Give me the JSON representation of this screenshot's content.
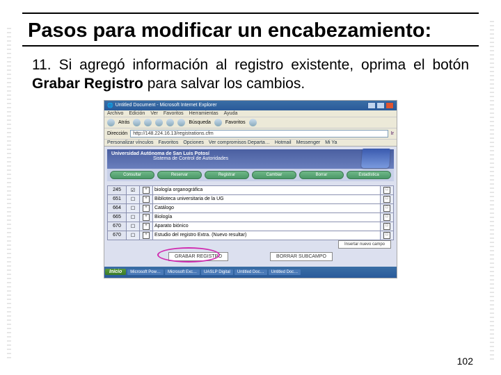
{
  "title": "Pasos para modificar un encabezamiento:",
  "body": {
    "prefix": "11. Si agregó información al registro existente, oprima el botón ",
    "bold": "Grabar Registro",
    "suffix": " para salvar los cambios."
  },
  "ie": {
    "title": "Untitled Document - Microsoft Internet Explorer",
    "menu": [
      "Archivo",
      "Edición",
      "Ver",
      "Favoritos",
      "Herramientas",
      "Ayuda"
    ],
    "tools_back": "Atrás",
    "tools_search": "Búsqueda",
    "tools_fav": "Favoritos",
    "addr_label": "Dirección",
    "addr_value": "http://148.224.16.13/registrations.cfm",
    "go": "Ir",
    "links": [
      "Personalizar vínculos",
      "Favoritos",
      "Opciones",
      "Ver compromisos Departa…",
      "Hotmail",
      "Messenger",
      "Mi Ya"
    ]
  },
  "app": {
    "uni": "Universidad Autónoma de San Luis Potosí",
    "system": "Sistema de Control de Autoridades",
    "nav": [
      "Consultar",
      "Reservar",
      "Registrar",
      "Cambiar",
      "Borrar",
      "Estadística"
    ],
    "rows": [
      {
        "code": "245",
        "chk": "☑",
        "text": "biología organográfica"
      },
      {
        "code": "651",
        "chk": "☐",
        "text": "Biblioteca universitaria de la UG"
      },
      {
        "code": "664",
        "chk": "☐",
        "text": "Catálogo"
      },
      {
        "code": "665",
        "chk": "☐",
        "text": "Biología"
      },
      {
        "code": "670",
        "chk": "☐",
        "text": "Aparato biónico"
      },
      {
        "code": "670",
        "chk": "☐",
        "text": "Estudio del registro Extra. (Nuevo resultar)"
      }
    ],
    "insert_label": "Insertar nuevo campo",
    "btn_save": "GRABAR  REGISTRO",
    "btn_delete": "BORRAR SUBCAMPO"
  },
  "taskbar": {
    "start": "Inicio",
    "items": [
      "Microsoft Pow…",
      "Microsoft Exc…",
      "UASLP Digital",
      "Untitled Doc…",
      "Untitled Doc…"
    ]
  },
  "page_number": "102"
}
